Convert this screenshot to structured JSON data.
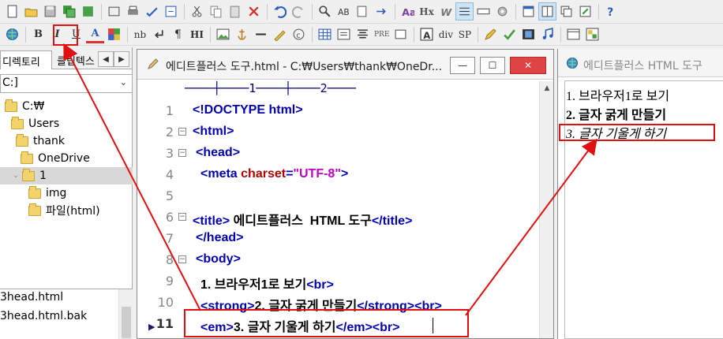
{
  "colors": {
    "annotation": "#e01010",
    "tag": "#0000b0",
    "attr": "#b00000",
    "string": "#c000c0"
  },
  "toolbar2": {
    "bold": "B",
    "italic": "I",
    "underline": "U",
    "color": "A",
    "nb": "nb",
    "hr": "HI",
    "pre": "PRE",
    "div": "div",
    "sp": "SP"
  },
  "toolbar1": {
    "hx": "Hx"
  },
  "left_panel": {
    "tabs": [
      "디렉토리",
      "클립텍스"
    ],
    "drive": "C:]",
    "tree": [
      {
        "label": "C:₩",
        "level": 0
      },
      {
        "label": "Users",
        "level": 1
      },
      {
        "label": "thank",
        "level": 2
      },
      {
        "label": "OneDrive",
        "level": 3
      },
      {
        "label": "1",
        "level": 4
      },
      {
        "label": "img",
        "level": 5
      },
      {
        "label": "파일(html)",
        "level": 5
      }
    ],
    "files": [
      "3head.html",
      "3head.html.bak"
    ]
  },
  "editor": {
    "title": "에디트플러스 도구.html - C:₩Users₩thank₩OneDr...",
    "min_label": "—",
    "max_label": "☐",
    "close_label": "✕",
    "ruler": "────┼────1────┼────2────",
    "lines": [
      {
        "num": "1",
        "code": "<!DOCTYPE html>"
      },
      {
        "num": "2",
        "code": "<html>"
      },
      {
        "num": "3",
        "code": "<head>"
      },
      {
        "num": "4",
        "code": "<meta charset=\"UTF-8\">"
      },
      {
        "num": "5",
        "code": ""
      },
      {
        "num": "6",
        "code": "<title> 에디트플러스  HTML 도구</title>"
      },
      {
        "num": "7",
        "code": "</head>"
      },
      {
        "num": "8",
        "code": "<body>"
      },
      {
        "num": "9",
        "code": "1. 브라우저1로 보기<br>"
      },
      {
        "num": "10",
        "code": "<strong>2. 글자 굵게 만들기</strong><br>"
      },
      {
        "num": "11",
        "code": "<em>3. 글자 기울게 하기</em><br>"
      }
    ]
  },
  "preview": {
    "title": "에디트플러스 HTML 도구",
    "lines": [
      "1. 브라우저1로 보기",
      "2. 글자 굵게 만들기",
      "3. 글자 기울게 하기"
    ]
  }
}
